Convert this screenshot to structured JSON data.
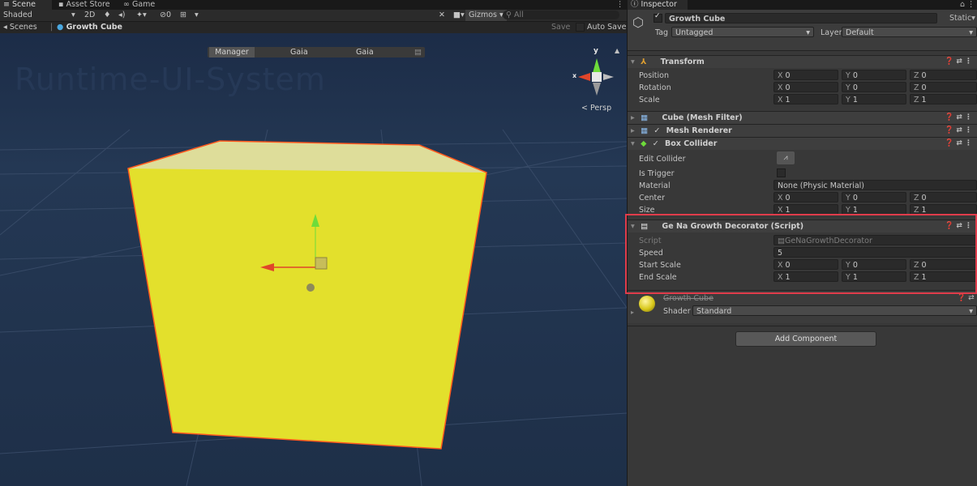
{
  "tabs": {
    "scene": "Scene",
    "asset_store": "Asset Store",
    "game": "Game",
    "inspector": "Inspector"
  },
  "toolbar": {
    "shading": "Shaded",
    "mode_2d": "2D",
    "fx_count": "0",
    "gizmos": "Gizmos",
    "search_placeholder": "All"
  },
  "breadcrumb": {
    "scenes": "Scenes",
    "object": "Growth Cube",
    "save": "Save",
    "auto_save": "Auto Save"
  },
  "overlay": {
    "manager": "Manager",
    "gaia1": "Gaia",
    "gaia2": "Gaia"
  },
  "viewport": {
    "watermark": "Runtime-UI-System",
    "persp": "Persp",
    "gizmo_y": "y",
    "gizmo_x": "x"
  },
  "object": {
    "name": "Growth Cube",
    "static": "Static",
    "tag_label": "Tag",
    "tag": "Untagged",
    "layer_label": "Layer",
    "layer": "Default"
  },
  "transform": {
    "title": "Transform",
    "position_label": "Position",
    "rotation_label": "Rotation",
    "scale_label": "Scale",
    "position": [
      "0",
      "0",
      "0"
    ],
    "rotation": [
      "0",
      "0",
      "0"
    ],
    "scale": [
      "1",
      "1",
      "1"
    ]
  },
  "components": {
    "mesh_filter": "Cube (Mesh Filter)",
    "mesh_renderer": "Mesh Renderer",
    "box_collider": "Box Collider"
  },
  "box_collider": {
    "edit_collider": "Edit Collider",
    "is_trigger": "Is Trigger",
    "material_label": "Material",
    "material": "None (Physic Material)",
    "center_label": "Center",
    "size_label": "Size",
    "center": [
      "0",
      "0",
      "0"
    ],
    "size": [
      "1",
      "1",
      "1"
    ]
  },
  "script": {
    "title": "Ge Na Growth Decorator (Script)",
    "script_label": "Script",
    "script_value": "GeNaGrowthDecorator",
    "speed_label": "Speed",
    "speed": "5",
    "start_scale_label": "Start Scale",
    "end_scale_label": "End Scale",
    "start_scale": [
      "0",
      "0",
      "0"
    ],
    "end_scale": [
      "1",
      "1",
      "1"
    ]
  },
  "material": {
    "name": "Growth Cube",
    "shader_label": "Shader",
    "shader": "Standard"
  },
  "add_component": "Add Component",
  "axes": {
    "x": "X",
    "y": "Y",
    "z": "Z"
  },
  "colors": {
    "cube_fill": "#e6e62a",
    "cube_outline": "#ff5a1e",
    "highlight_box": "#e03c4b",
    "sky": "#1f2d45"
  }
}
